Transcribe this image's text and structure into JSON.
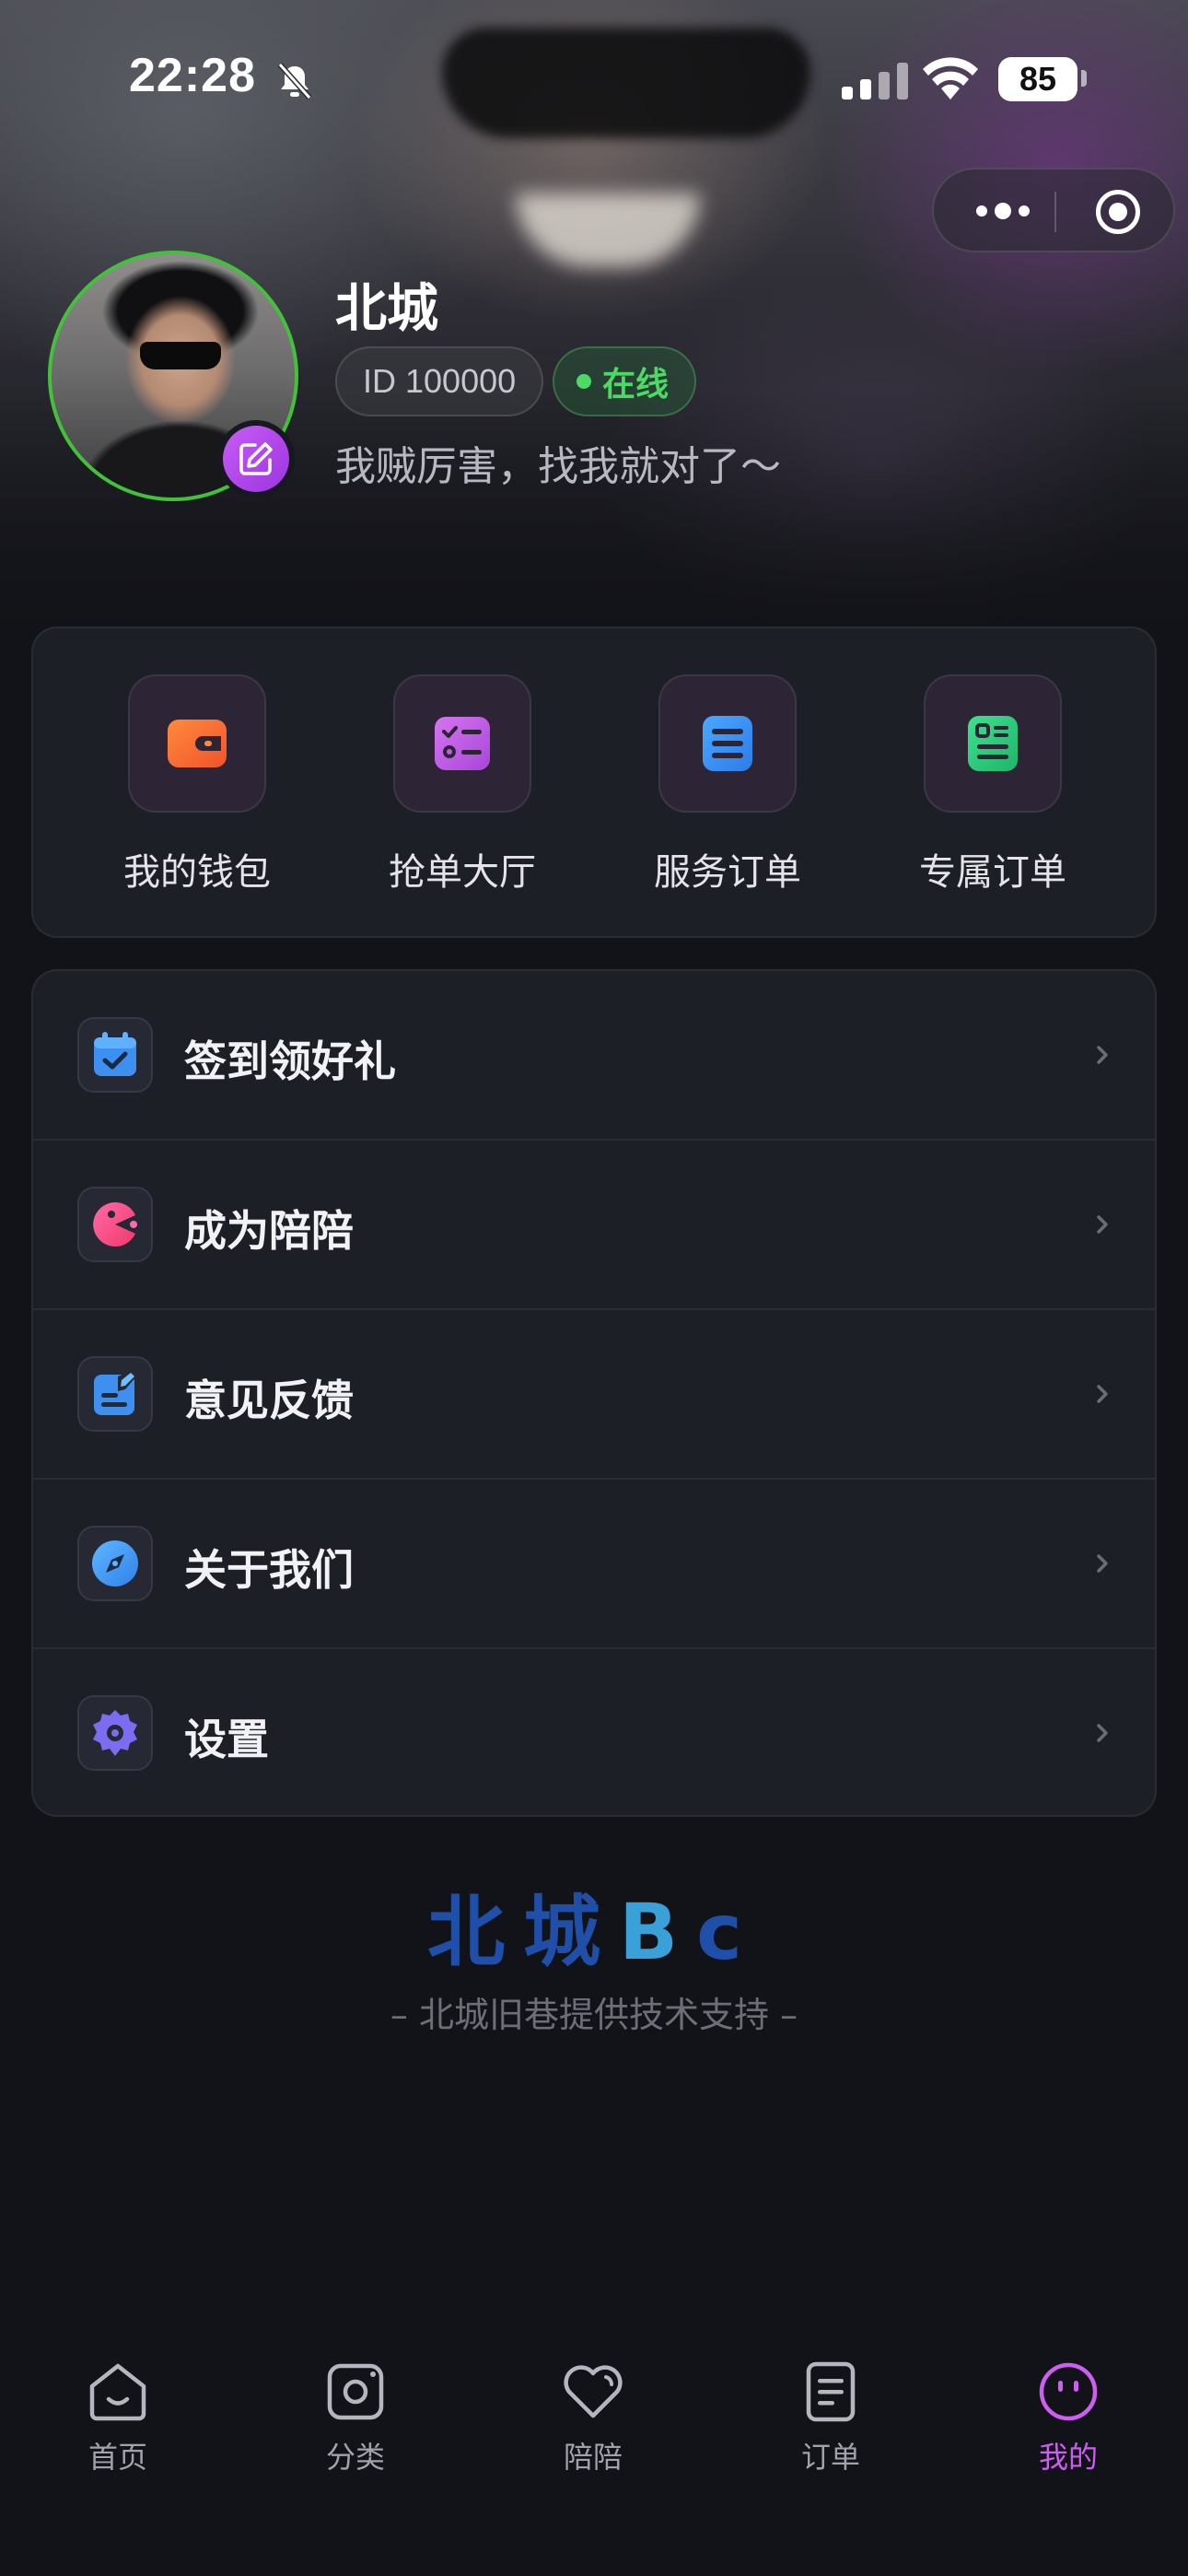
{
  "status_bar": {
    "time": "22:28",
    "battery": "85"
  },
  "profile": {
    "name": "北城",
    "id_text": "ID 100000",
    "status": "在线",
    "bio": "我贼厉害，找我就对了～"
  },
  "quick_actions": [
    {
      "label": "我的钱包",
      "icon": "wallet-icon",
      "color": "#f06a3a"
    },
    {
      "label": "抢单大厅",
      "icon": "task-list-icon",
      "color": "#c65fe6"
    },
    {
      "label": "服务订单",
      "icon": "stack-icon",
      "color": "#3b8ff0"
    },
    {
      "label": "专属订单",
      "icon": "receipt-icon",
      "color": "#2fcf7e"
    }
  ],
  "menu": [
    {
      "label": "签到领好礼",
      "icon": "calendar-check-icon"
    },
    {
      "label": "成为陪陪",
      "icon": "pacman-icon"
    },
    {
      "label": "意见反馈",
      "icon": "feedback-edit-icon"
    },
    {
      "label": "关于我们",
      "icon": "compass-icon"
    },
    {
      "label": "设置",
      "icon": "gear-icon"
    }
  ],
  "brand": {
    "logo_part1": "北城",
    "logo_part2": "B",
    "logo_part3": "c",
    "tagline": "– 北城旧巷提供技术支持 –"
  },
  "tab_bar": {
    "active_color": "#cc5ef0",
    "tabs": [
      {
        "label": "首页",
        "icon": "home-icon"
      },
      {
        "label": "分类",
        "icon": "category-icon"
      },
      {
        "label": "陪陪",
        "icon": "heart-icon"
      },
      {
        "label": "订单",
        "icon": "order-icon"
      },
      {
        "label": "我的",
        "icon": "profile-face-icon",
        "active": true
      }
    ]
  }
}
